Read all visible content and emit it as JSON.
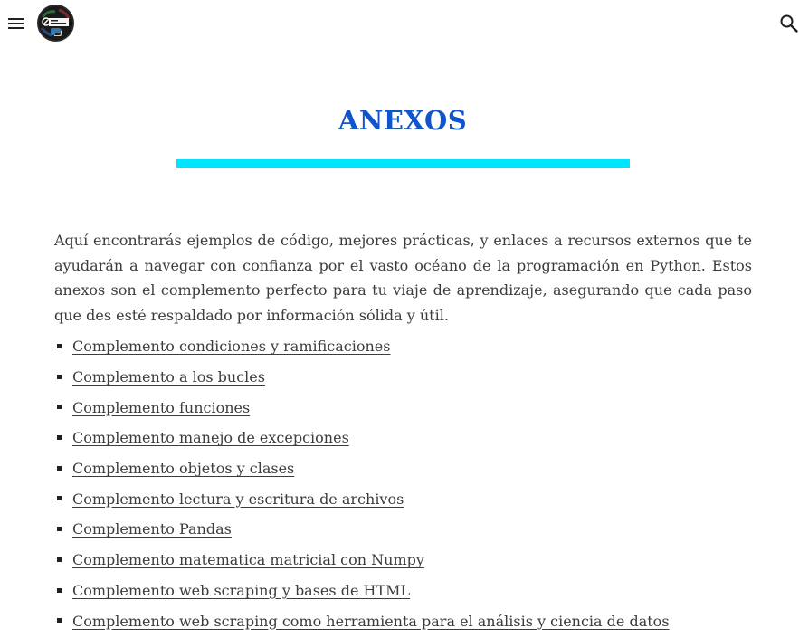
{
  "header": {
    "menu_icon": "menu-icon",
    "logo_icon": "site-logo",
    "search_icon": "search-icon"
  },
  "page": {
    "title": "ANEXOS",
    "intro": "Aquí encontrarás ejemplos de código, mejores prácticas, y enlaces a recursos externos que te ayudarán a navegar con confianza por el vasto océano de la programación en Python. Estos anexos son el complemento perfecto para tu viaje de aprendizaje, asegurando que cada paso que des esté respaldado por información sólida y útil."
  },
  "links": [
    {
      "label": "Complemento condiciones y ramificaciones"
    },
    {
      "label": "Complemento a los bucles"
    },
    {
      "label": "Complemento funciones"
    },
    {
      "label": "Complemento manejo de excepciones"
    },
    {
      "label": "Complemento objetos y clases"
    },
    {
      "label": "Complemento lectura y escritura de archivos"
    },
    {
      "label": "Complemento Pandas"
    },
    {
      "label": "Complemento matematica matricial con Numpy"
    },
    {
      "label": "Complemento web scraping y bases de HTML"
    },
    {
      "label": "Complemento web scraping como herramienta para el análisis y ciencia de datos"
    }
  ],
  "colors": {
    "title": "#1155cc",
    "title_rule": "#00e5ff",
    "text": "#3c3c3c"
  }
}
